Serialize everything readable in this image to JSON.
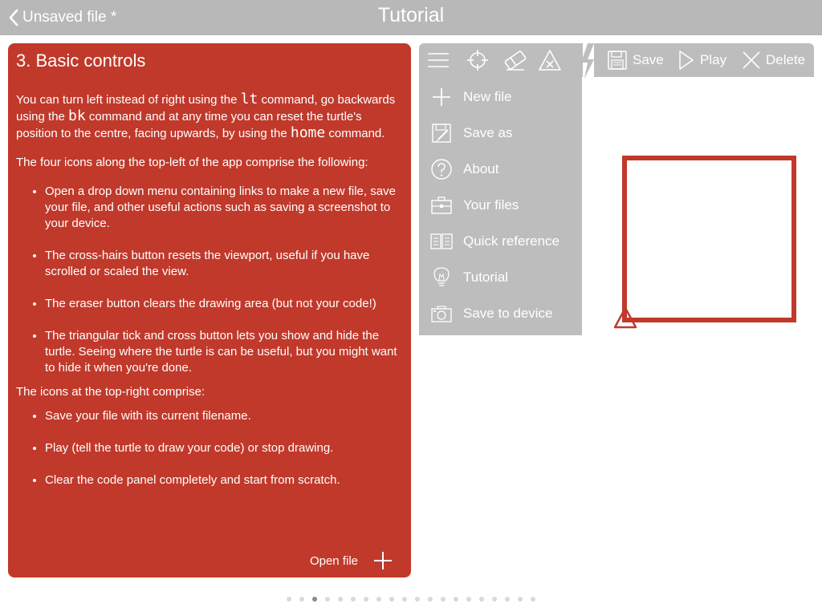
{
  "nav": {
    "back_label": "Unsaved file *",
    "title": "Tutorial"
  },
  "card": {
    "title": "3. Basic controls",
    "intro": {
      "t1": "You can turn left instead of right using the ",
      "c1": "lt",
      "t2": " command, go backwards using the ",
      "c2": "bk",
      "t3": " command and at any time you can reset the turtle's position to the centre, facing upwards, by using the ",
      "c3": "home",
      "t4": " command."
    },
    "para2": "The four icons along the top-left of the app comprise the following:",
    "list1": [
      "Open a drop down menu containing links to make a new file, save your file, and other useful actions such as saving a screenshot to your device.",
      "The cross-hairs button resets the viewport, useful if you have scrolled or scaled the view.",
      "The eraser button clears the drawing area (but not your code!)",
      "The triangular tick and cross button lets you show and hide the turtle. Seeing where the turtle is can be useful, but you might want to hide it when you're done."
    ],
    "para3": "The icons at the top-right comprise:",
    "list2": [
      "Save your file with its current filename.",
      "Play (tell the turtle to draw your code) or stop drawing.",
      "Clear the code panel completely and start from scratch."
    ],
    "footer": {
      "open_file_label": "Open file"
    }
  },
  "toolbar": {
    "left_icons": [
      "menu-icon",
      "crosshair-icon",
      "eraser-icon",
      "turtle-toggle-icon"
    ],
    "save_label": "Save",
    "play_label": "Play",
    "delete_label": "Delete"
  },
  "menu": {
    "items": [
      {
        "label": "New file",
        "icon": "plus-icon"
      },
      {
        "label": "Save as",
        "icon": "save-as-icon"
      },
      {
        "label": "About",
        "icon": "question-icon"
      },
      {
        "label": "Your files",
        "icon": "briefcase-icon"
      },
      {
        "label": "Quick reference",
        "icon": "book-icon"
      },
      {
        "label": "Tutorial",
        "icon": "lightbulb-icon"
      },
      {
        "label": "Save to device",
        "icon": "camera-icon"
      }
    ]
  },
  "pagination": {
    "total": 20,
    "current": 3
  },
  "colors": {
    "accent": "#c0392b",
    "toolbar": "#bdbdbd",
    "navbar": "#b8b8b8"
  }
}
